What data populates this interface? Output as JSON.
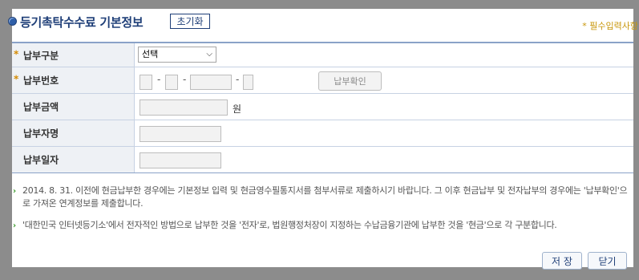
{
  "header": {
    "title": "등기촉탁수수료 기본정보",
    "reset_label": "초기화",
    "required_note": "* 필수입력사항"
  },
  "form": {
    "rows": [
      {
        "label": "납부구분",
        "required": true
      },
      {
        "label": "납부번호",
        "required": true
      },
      {
        "label": "납부금액",
        "required": false
      },
      {
        "label": "납부자명",
        "required": false
      },
      {
        "label": "납부일자",
        "required": false
      }
    ],
    "payment_type": {
      "selected": "선택"
    },
    "payment_number": {
      "separator": "-",
      "confirm_label": "납부확인"
    },
    "amount": {
      "value": "",
      "unit": "원"
    },
    "payer_name": {
      "value": ""
    },
    "payment_date": {
      "value": ""
    }
  },
  "notes": [
    "2014. 8. 31. 이전에 현금납부한 경우에는 기본정보 입력 및 현금영수필통지서를 첨부서류로 제출하시기 바랍니다. 그 이후 현금납부 및 전자납부의 경우에는 '납부확인'으로 가져온 연계정보를 제출합니다.",
    "'대한민국 인터넷등기소'에서 전자적인 방법으로 납부한 것을 '전자'로, 법원행정처장이 지정하는 수납금융기관에 납부한 것을 '현금'으로 각 구분합니다."
  ],
  "footer": {
    "save_label": "저 장",
    "close_label": "닫기"
  },
  "colors": {
    "title": "#1f3f78",
    "required_star": "#d48a00",
    "note_arrow": "#3a9a2a",
    "label_bg": "#eef1f5"
  }
}
